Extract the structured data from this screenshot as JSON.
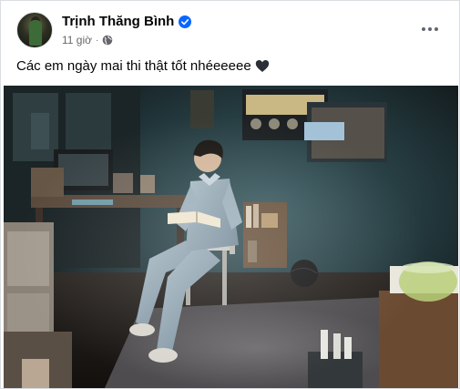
{
  "post": {
    "author_name": "Trịnh Thăng Bình",
    "verified": true,
    "timestamp": "11 giờ",
    "separator": "·",
    "audience_icon": "globe-icon",
    "text": "Các em ngày mai thi thật tốt nhéeeeee",
    "emoji_icon": "black-heart-icon",
    "photo_subject": "man in denim reading a book in a dim study room"
  },
  "colors": {
    "verified_blue": "#0866ff",
    "meta_gray": "#65676b",
    "text": "#050505"
  }
}
